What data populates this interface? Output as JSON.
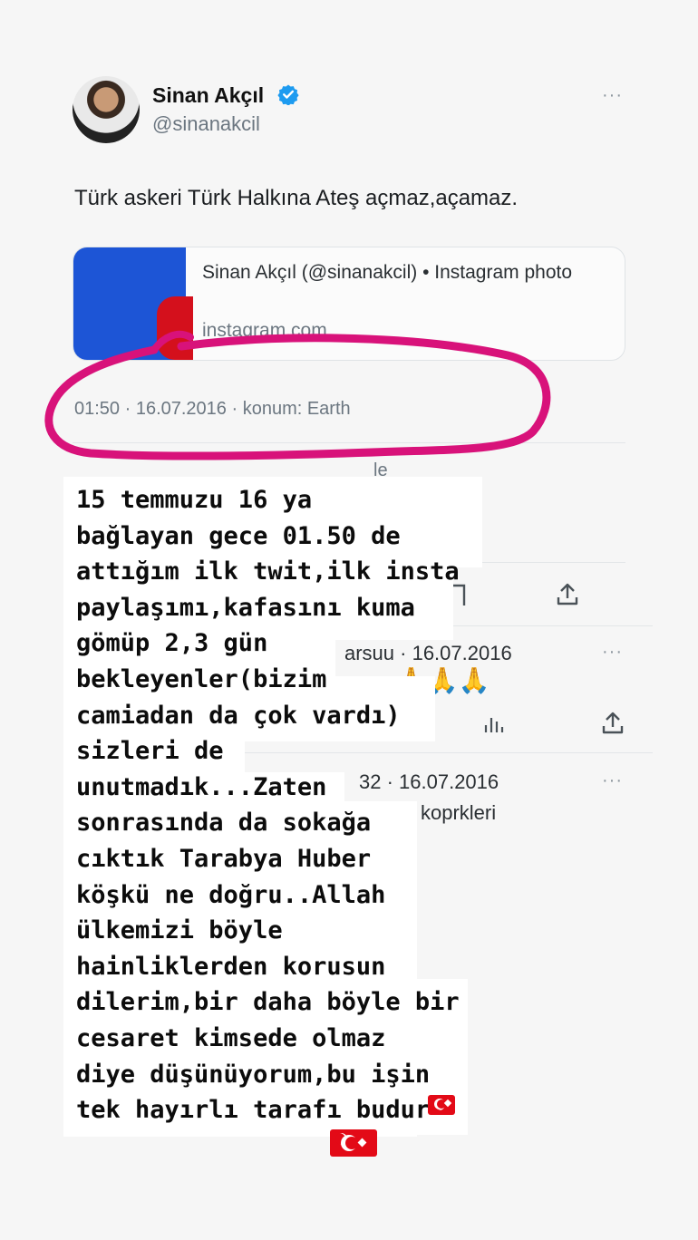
{
  "tweet": {
    "author_name": "Sinan Akçıl",
    "author_handle": "@sinanakcil",
    "more_label": "···",
    "text": "Türk askeri Türk Halkına Ateş açmaz,açamaz.",
    "link_card": {
      "title": "Sinan Akçıl (@sinanakcil) • Instagram photo",
      "domain": "instagram.com"
    },
    "meta": "01:50 · 16.07.2016 · konum: Earth"
  },
  "background_fragments": {
    "frag_le": "le",
    "reply1_meta": "arsuu · 16.07.2016",
    "reply2_meta": "32 · 16.07.2016",
    "reply2_text": "koprkleri"
  },
  "overlay": {
    "text": "15 temmuzu 16 ya\nbağlayan gece 01.50 de\nattığım ilk twit,ilk insta\npaylaşımı,kafasını kuma\ngömüp 2,3 gün\nbekleyenler(bizim\ncamiadan da çok vardı)\nsizleri de\nunutmadık...Zaten\nsonrasında da sokağa\ncıktık Tarabya Huber\nköşkü ne doğru..Allah\nülkemizi böyle\nhainliklerden korusun\ndilerim,bir daha böyle bir\ncesaret kimsede olmaz\ndiye düşünüyorum,bu işin\ntek hayırlı tarafı budur"
  },
  "colors": {
    "highlight_circle": "#d8127a",
    "verified": "#1d9bf0",
    "flag_red": "#e30a17"
  },
  "icons": [
    "verified-badge-icon",
    "more-options-icon",
    "share-icon",
    "stats-icon",
    "pray-emoji-icon",
    "turkish-flag-icon"
  ]
}
